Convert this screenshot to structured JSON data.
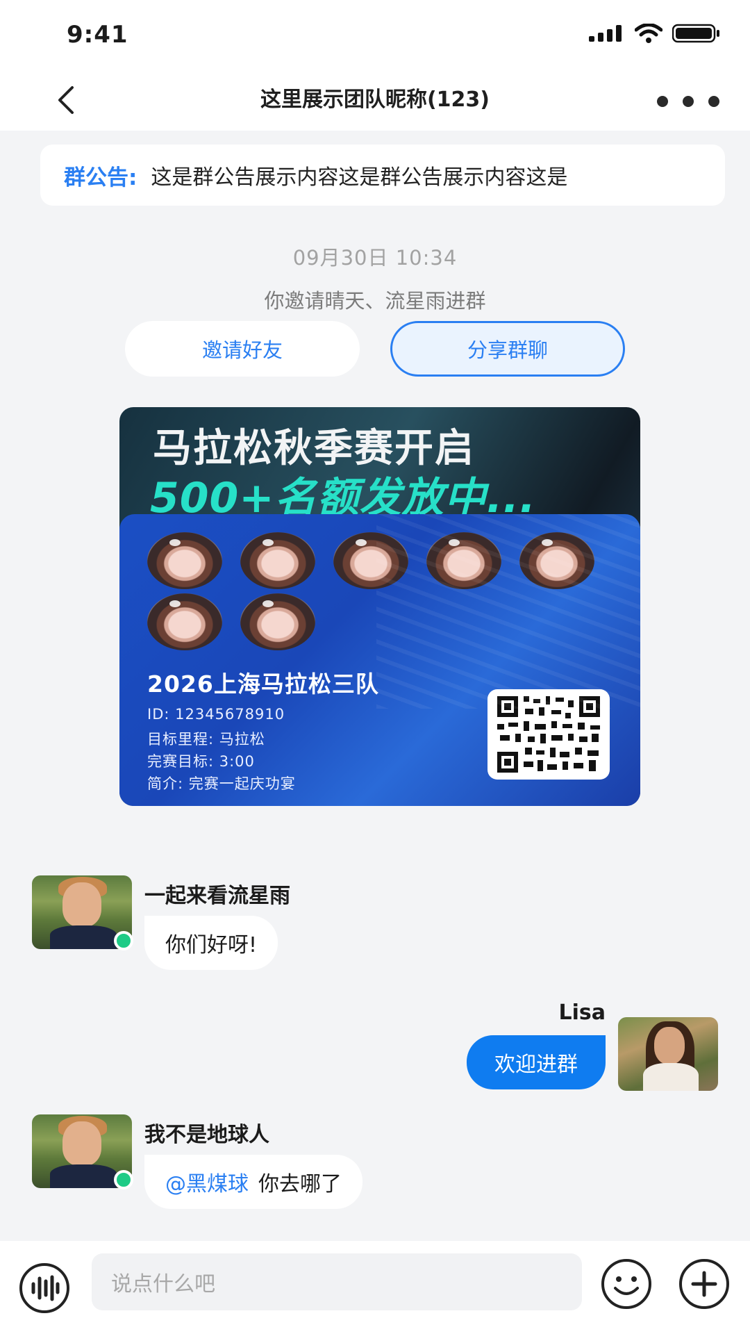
{
  "status": {
    "time": "9:41"
  },
  "header": {
    "title": "这里展示团队昵称(123)"
  },
  "notice": {
    "label": "群公告:",
    "text": "这是群公告展示内容这是群公告展示内容这是"
  },
  "system": {
    "timestamp": "09月30日   10:34",
    "message": "你邀请晴天、流星雨进群",
    "invite_label": "邀请好友",
    "share_label": "分享群聊"
  },
  "poster": {
    "headline": "马拉松秋季赛开启",
    "subheadline": "500+名额发放中...",
    "team_name": "2026上海马拉松三队",
    "info": [
      "ID: 12345678910",
      "目标里程: 马拉松",
      "完赛目标: 3:00",
      "简介: 完赛一起庆功宴"
    ],
    "member_count": 7
  },
  "messages": [
    {
      "sender": "一起来看流星雨",
      "text": "你们好呀!",
      "side": "left"
    },
    {
      "sender": "Lisa",
      "text": "欢迎进群",
      "side": "right"
    },
    {
      "sender": "我不是地球人",
      "mention": "@黑煤球",
      "text": "你去哪了",
      "side": "left"
    }
  ],
  "input": {
    "placeholder": "说点什么吧"
  },
  "colors": {
    "accent": "#2a7ff2",
    "bubble_self": "#0f7cf0",
    "online": "#1ecb86",
    "poster_highlight": "#27e0c8"
  },
  "icons": [
    "back-arrow-icon",
    "more-dots-icon",
    "voice-icon",
    "emoji-icon",
    "plus-icon",
    "qr-code-icon"
  ]
}
